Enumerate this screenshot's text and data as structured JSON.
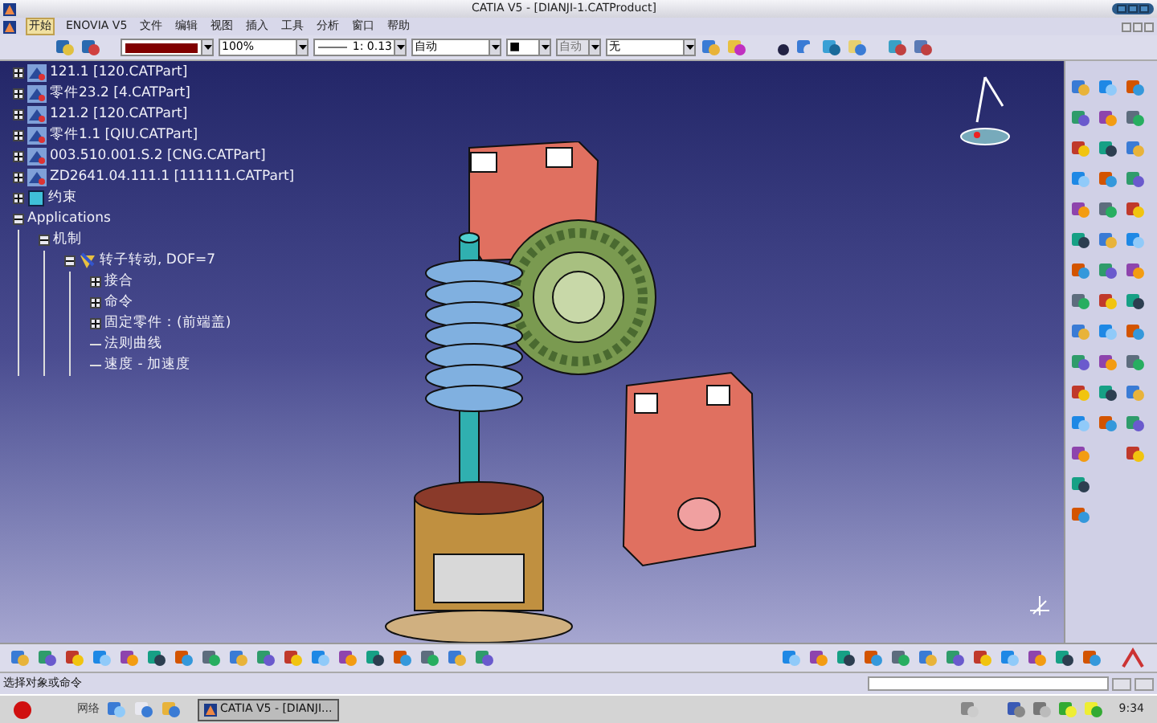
{
  "window": {
    "title": "CATIA V5 - [DIANJI-1.CATProduct]"
  },
  "menu": [
    {
      "label": "开始",
      "highlighted": true
    },
    {
      "label": "ENOVIA V5",
      "highlighted": false
    },
    {
      "label": "文件",
      "highlighted": false
    },
    {
      "label": "编辑",
      "highlighted": false
    },
    {
      "label": "视图",
      "highlighted": false
    },
    {
      "label": "插入",
      "highlighted": false
    },
    {
      "label": "工具",
      "highlighted": false
    },
    {
      "label": "分析",
      "highlighted": false
    },
    {
      "label": "窗口",
      "highlighted": false
    },
    {
      "label": "帮助",
      "highlighted": false
    }
  ],
  "toolbar_fields": [
    {
      "kind": "color",
      "color": "#800000"
    },
    {
      "kind": "text",
      "value": "100%",
      "disabled": false
    },
    {
      "kind": "line",
      "value": "1: 0.13"
    },
    {
      "kind": "text",
      "value": "自动",
      "disabled": false
    },
    {
      "kind": "text",
      "value": "■",
      "disabled": false
    },
    {
      "kind": "text",
      "value": "自动",
      "disabled": true
    },
    {
      "kind": "text",
      "value": "无",
      "disabled": false
    }
  ],
  "tree": [
    {
      "label": "121.1 [120.CATPart]",
      "kind": "part",
      "expanded": false
    },
    {
      "label": "零件23.2 [4.CATPart]",
      "kind": "part",
      "expanded": false
    },
    {
      "label": "121.2 [120.CATPart]",
      "kind": "part",
      "expanded": false
    },
    {
      "label": "零件1.1 [QIU.CATPart]",
      "kind": "part",
      "expanded": false
    },
    {
      "label": "003.510.001.S.2 [CNG.CATPart]",
      "kind": "part",
      "expanded": false
    },
    {
      "label": "ZD2641.04.111.1 [111111.CATPart]",
      "kind": "part",
      "expanded": false
    },
    {
      "label": "约束",
      "kind": "constraints",
      "expanded": false
    },
    {
      "label": "Applications",
      "expanded": true,
      "children": [
        {
          "label": "机制",
          "expanded": true,
          "children": [
            {
              "label": "转子转动, DOF=7",
              "kind": "mechanism",
              "expanded": true,
              "children": [
                {
                  "label": "接合",
                  "expanded": false
                },
                {
                  "label": "命令",
                  "expanded": false
                },
                {
                  "label": "固定零件：(前端盖)",
                  "expanded": false
                },
                {
                  "label": "法则曲线"
                },
                {
                  "label": "速度 - 加速度"
                }
              ]
            }
          ]
        }
      ]
    }
  ],
  "status_bar": {
    "prompt": "选择对象或命令"
  },
  "taskbar": {
    "quick_launch_label": "网络",
    "tasks": [
      {
        "label": "CATIA V5 - [DIANJI...",
        "selected": true
      }
    ],
    "clock": "9:34"
  }
}
